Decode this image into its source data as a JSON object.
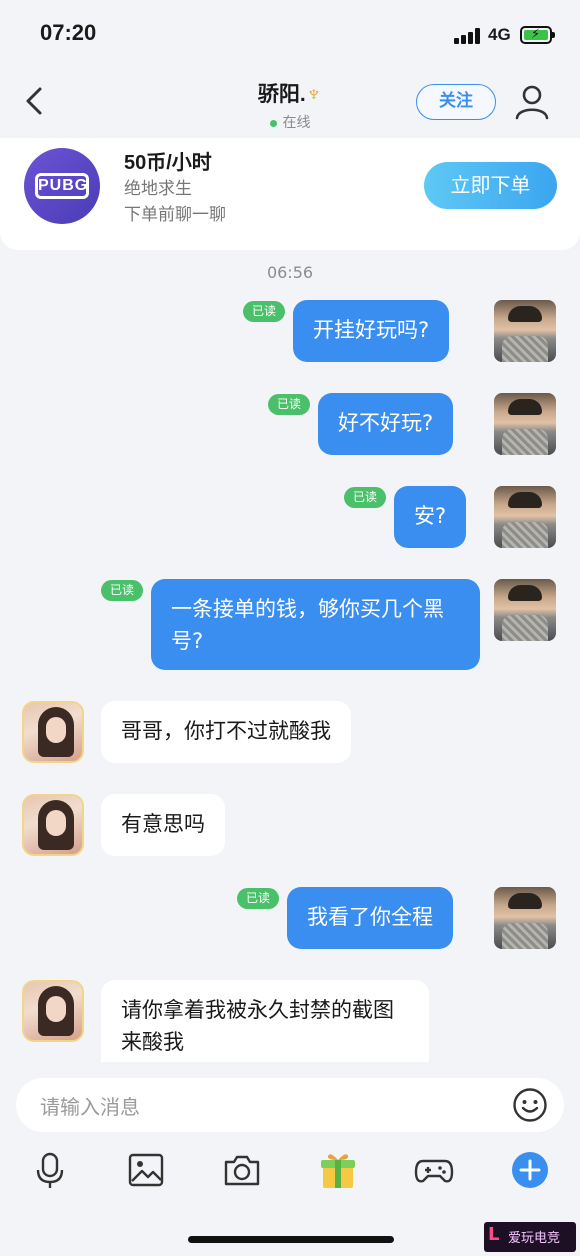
{
  "status_bar": {
    "time": "07:20",
    "network": "4G",
    "battery": "charging"
  },
  "header": {
    "back_icon": "chevron-left-icon",
    "name": "骄阳.",
    "name_badge_icon": "trident-icon",
    "presence": "在线",
    "follow_label": "关注",
    "profile_icon": "user-icon"
  },
  "service": {
    "game_logo_text": "PUBG",
    "price": "50币/小时",
    "game": "绝地求生",
    "hint": "下单前聊一聊",
    "order_label": "立即下单"
  },
  "chat": {
    "timestamp": "06:56",
    "read_label": "已读",
    "messages": [
      {
        "from": "me",
        "text": "开挂好玩吗?",
        "read": true
      },
      {
        "from": "me",
        "text": "好不好玩?",
        "read": true
      },
      {
        "from": "me",
        "text": "安?",
        "read": true
      },
      {
        "from": "me",
        "text": "一条接单的钱，够你买几个黑号?",
        "read": true
      },
      {
        "from": "her",
        "text": "哥哥，你打不过就酸我"
      },
      {
        "from": "her",
        "text": "有意思吗"
      },
      {
        "from": "me",
        "text": "我看了你全程",
        "read": true
      },
      {
        "from": "her",
        "text": "请你拿着我被永久封禁的截图来酸我"
      }
    ]
  },
  "composer": {
    "placeholder": "请输入消息",
    "emoji_icon": "smiley-icon",
    "tools": [
      "microphone-icon",
      "image-icon",
      "camera-icon",
      "gift-icon",
      "gamepad-icon",
      "plus-icon"
    ]
  },
  "colors": {
    "accent": "#3a8ef0",
    "read_badge": "#4bc06a",
    "order_gradient_start": "#5ec9f4",
    "order_gradient_end": "#3ba5ef"
  },
  "watermark": {
    "mark": "L",
    "text": "爱玩电竞"
  }
}
